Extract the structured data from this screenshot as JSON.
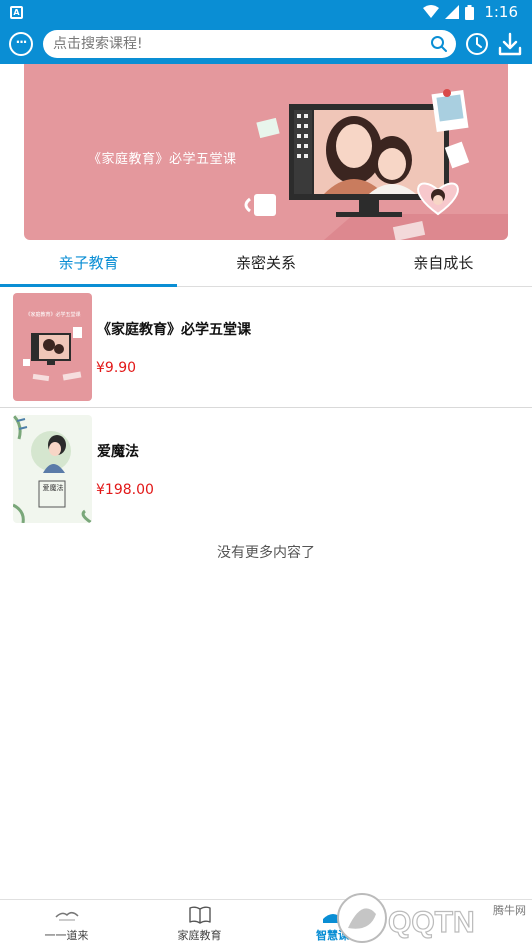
{
  "status_bar": {
    "time": "1:16",
    "app_icon": "A"
  },
  "header": {
    "search_placeholder": "点击搜索课程!"
  },
  "banner": {
    "title": "《家庭教育》必学五堂课"
  },
  "tabs": [
    {
      "label": "亲子教育",
      "active": true
    },
    {
      "label": "亲密关系",
      "active": false
    },
    {
      "label": "亲自成长",
      "active": false
    }
  ],
  "courses": [
    {
      "title": "《家庭教育》必学五堂课",
      "price": "¥9.90",
      "cover_text": "《家庭教育》必学五堂课"
    },
    {
      "title": "爱魔法",
      "price": "¥198.00",
      "cover_text": "爱魔法"
    }
  ],
  "no_more_text": "没有更多内容了",
  "bottom_nav": [
    {
      "label": "一一道来",
      "icon": "ink-landscape-icon",
      "active": false
    },
    {
      "label": "家庭教育",
      "icon": "book-icon",
      "active": false
    },
    {
      "label": "智慧课",
      "icon": "wisdom-course-icon",
      "active": true
    }
  ],
  "watermark": {
    "brand": "腾牛网",
    "logo_text": "QQTN"
  },
  "colors": {
    "primary": "#0a8ed4",
    "banner": "#e4989d",
    "price": "#e21818"
  }
}
